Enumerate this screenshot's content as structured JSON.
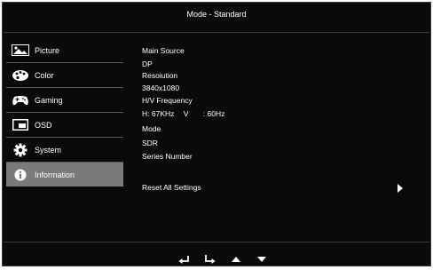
{
  "header": {
    "title": "Mode - Standard"
  },
  "menu": [
    {
      "label": "Picture",
      "icon": "picture-icon",
      "active": false
    },
    {
      "label": "Color",
      "icon": "palette-icon",
      "active": false
    },
    {
      "label": "Gaming",
      "icon": "gamepad-icon",
      "active": false
    },
    {
      "label": "OSD",
      "icon": "osd-window-icon",
      "active": false
    },
    {
      "label": "System",
      "icon": "gear-icon",
      "active": false
    },
    {
      "label": "Information",
      "icon": "info-icon",
      "active": true
    }
  ],
  "info": {
    "main_source_label": "Main Source",
    "main_source_value": "DP",
    "resolution_label": "Resoiution",
    "resolution_value": "3840x1080",
    "hv_label": "H/V Frequency",
    "h_prefix": "H:",
    "h_value": "67KHz",
    "v_prefix": "V",
    "v_value": ": 60Hz",
    "mode_label": "Mode",
    "mode_value": "SDR",
    "series_label": "Series Number"
  },
  "reset": {
    "label": "Reset All Settings"
  },
  "nav": [
    "return-icon",
    "enter-icon",
    "up-arrow-icon",
    "down-arrow-icon"
  ]
}
